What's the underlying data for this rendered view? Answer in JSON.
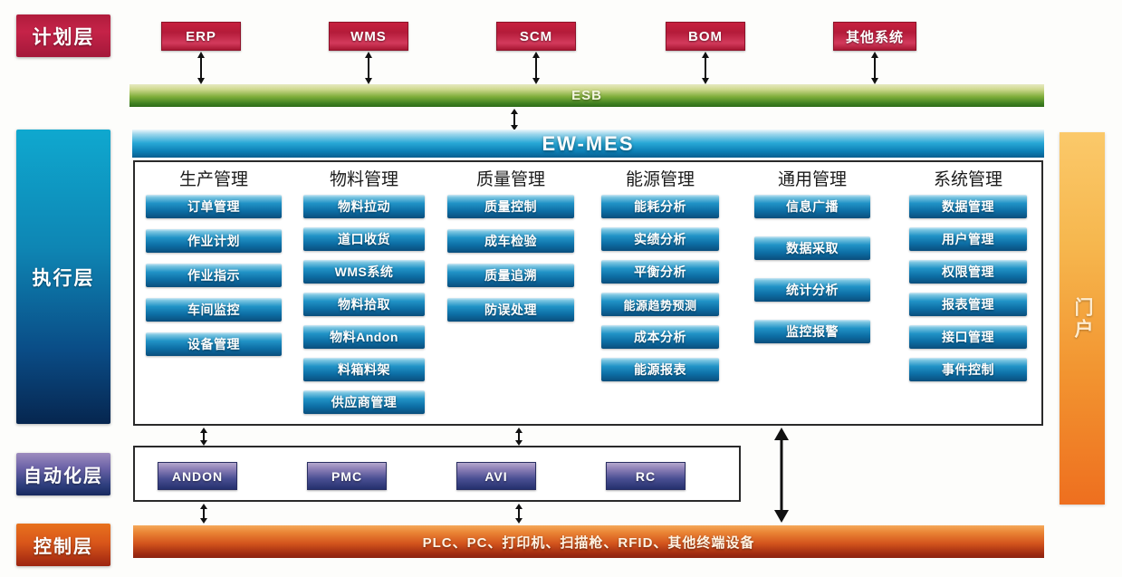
{
  "layers": {
    "planning": "计划层",
    "execution": "执行层",
    "automation": "自动化层",
    "control": "控制层"
  },
  "portal": {
    "label": "门户"
  },
  "top_systems": [
    {
      "label": "ERP"
    },
    {
      "label": "WMS"
    },
    {
      "label": "SCM"
    },
    {
      "label": "BOM"
    },
    {
      "label": "其他系统"
    }
  ],
  "esb": {
    "label": "ESB"
  },
  "mes": {
    "label": "EW-MES"
  },
  "modules": [
    {
      "title": "生产管理",
      "items": [
        "订单管理",
        "作业计划",
        "作业指示",
        "车间监控",
        "设备管理"
      ]
    },
    {
      "title": "物料管理",
      "items": [
        "物料拉动",
        "道口收货",
        "WMS系统",
        "物料拾取",
        "物料Andon",
        "料箱料架",
        "供应商管理"
      ]
    },
    {
      "title": "质量管理",
      "items": [
        "质量控制",
        "成车检验",
        "质量追溯",
        "防误处理"
      ]
    },
    {
      "title": "能源管理",
      "items": [
        "能耗分析",
        "实绩分析",
        "平衡分析",
        "能源趋势预测",
        "成本分析",
        "能源报表"
      ]
    },
    {
      "title": "通用管理",
      "items": [
        "信息广播",
        "数据采取",
        "统计分析",
        "监控报警"
      ]
    },
    {
      "title": "系统管理",
      "items": [
        "数据管理",
        "用户管理",
        "权限管理",
        "报表管理",
        "接口管理",
        "事件控制"
      ]
    }
  ],
  "automation_items": [
    {
      "label": "ANDON"
    },
    {
      "label": "PMC"
    },
    {
      "label": "AVI"
    },
    {
      "label": "RC"
    }
  ],
  "control": {
    "label": "PLC、PC、打印机、扫描枪、RFID、其他终端设备"
  },
  "colors": {
    "planning_red": "#b41b39",
    "esb_green": "#3f8021",
    "mes_blue": "#0c7fb5",
    "portal_orange": "#f29430",
    "automation_purple": "#4a4f93",
    "control_orange": "#d4551d",
    "module_blue": "#0d6fa6"
  }
}
